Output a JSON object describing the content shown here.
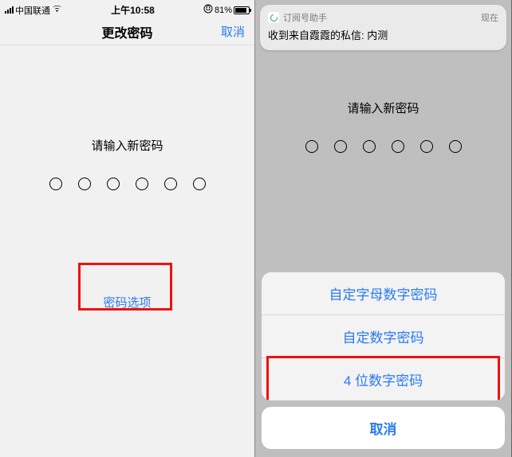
{
  "status": {
    "carrier": "中国联通",
    "time": "上午10:58",
    "batteryPercent": "81%"
  },
  "nav": {
    "title": "更改密码",
    "cancel": "取消"
  },
  "body": {
    "prompt": "请输入新密码",
    "optionsLink": "密码选项"
  },
  "notification": {
    "appName": "订阅号助手",
    "when": "现在",
    "message": "收到来自霞霞的私信: 内测"
  },
  "sheet": {
    "items": [
      "自定字母数字密码",
      "自定数字密码",
      "4 位数字密码"
    ],
    "cancel": "取消"
  }
}
